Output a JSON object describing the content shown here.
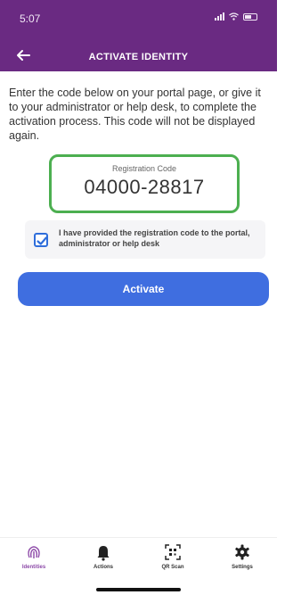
{
  "status_bar": {
    "time": "5:07"
  },
  "header": {
    "title": "ACTIVATE IDENTITY",
    "back_icon": "arrow-left-icon"
  },
  "instructions": "Enter the code below on your portal page, or give it to your administrator or help desk, to complete the activation process. This code will not be displayed again.",
  "registration": {
    "label": "Registration Code",
    "code": "04000-28817"
  },
  "confirmation": {
    "checked": true,
    "text": "I have provided the registration code to the portal, administrator or help desk"
  },
  "actions": {
    "activate_label": "Activate"
  },
  "tabs": [
    {
      "label": "Identities",
      "icon": "fingerprint-icon",
      "active": true
    },
    {
      "label": "Actions",
      "icon": "bell-icon",
      "active": false
    },
    {
      "label": "QR Scan",
      "icon": "qr-scan-icon",
      "active": false
    },
    {
      "label": "Settings",
      "icon": "gear-icon",
      "active": false
    }
  ],
  "colors": {
    "header_bg": "#6a2a82",
    "button_bg": "#3f6ee0",
    "highlight": "#4caf50",
    "active_tab": "#8d4aa8"
  }
}
